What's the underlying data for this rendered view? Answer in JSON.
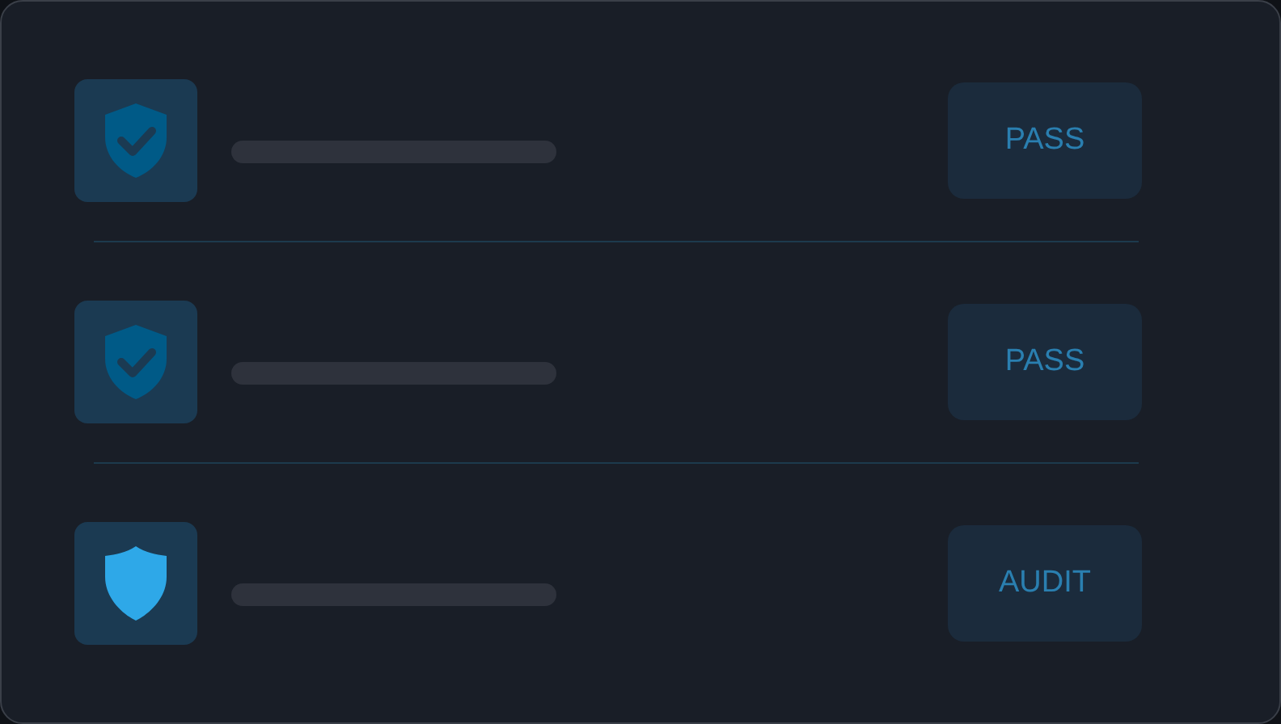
{
  "rows": [
    {
      "kind": "pass",
      "status": "PASS"
    },
    {
      "kind": "pass",
      "status": "PASS"
    },
    {
      "kind": "audit",
      "status": "AUDIT"
    }
  ]
}
